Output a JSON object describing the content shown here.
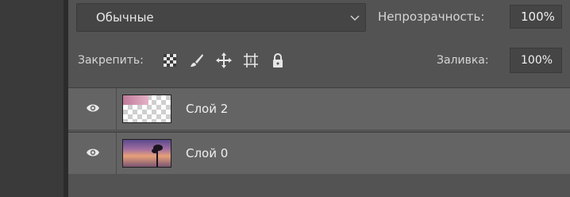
{
  "blend_mode": {
    "value": "Обычные",
    "chevron_icon": "chevron-down-icon"
  },
  "opacity": {
    "label": "Непрозрачность:",
    "value": "100%"
  },
  "lock": {
    "label": "Закрепить:",
    "icons": [
      "lock-transparent-pixels-icon",
      "lock-image-pixels-icon",
      "lock-position-icon",
      "lock-artboard-icon",
      "lock-all-icon"
    ]
  },
  "fill": {
    "label": "Заливка:",
    "value": "100%"
  },
  "layers": [
    {
      "name": "Слой 2",
      "visible": true,
      "thumbnail": "transparent-with-pink-stroke"
    },
    {
      "name": "Слой 0",
      "visible": true,
      "thumbnail": "sunset-photo"
    }
  ]
}
